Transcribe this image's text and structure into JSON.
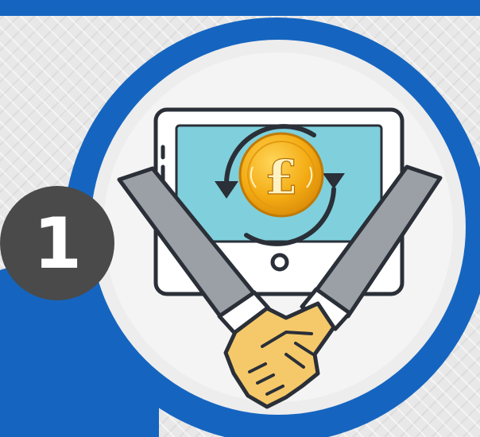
{
  "step": {
    "number": "1"
  },
  "icons": {
    "main": "handshake-icon",
    "coin": "pound-coin-icon",
    "exchange": "circular-arrows-icon",
    "device": "tablet-icon"
  },
  "colors": {
    "brand_blue": "#1565c0",
    "badge_gray": "#4a4a4a",
    "screen_teal": "#7fd0dc",
    "sleeve_gray": "#9aa0a6",
    "hand_yellow": "#f5c96a",
    "coin_gold": "#f2a916"
  }
}
